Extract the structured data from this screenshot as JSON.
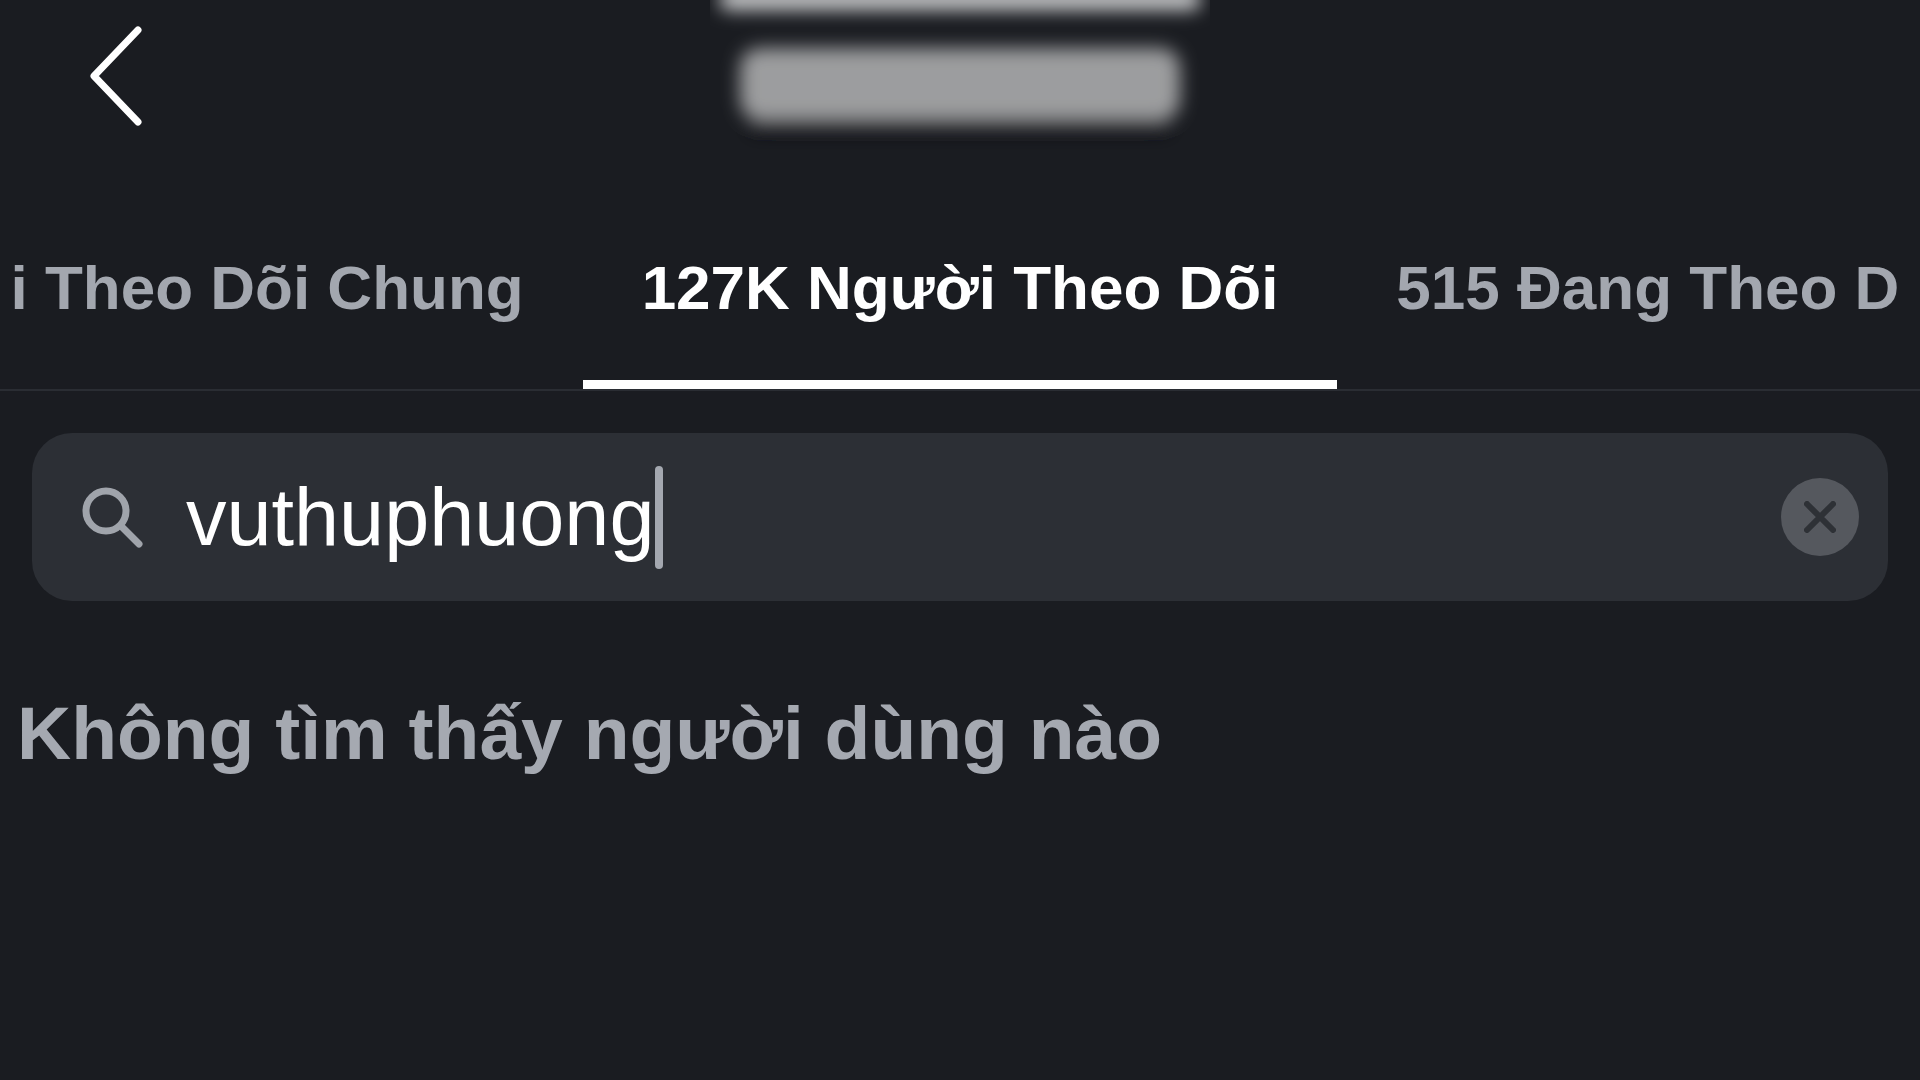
{
  "tabs": [
    {
      "label": "i Theo Dõi Chung",
      "selected": false
    },
    {
      "label": "127K Người Theo Dõi",
      "selected": true
    },
    {
      "label": "515 Đang Theo D",
      "selected": false
    }
  ],
  "search": {
    "value": "vuthuphuong",
    "focused": true
  },
  "empty_message": "Không tìm thấy người dùng nào"
}
